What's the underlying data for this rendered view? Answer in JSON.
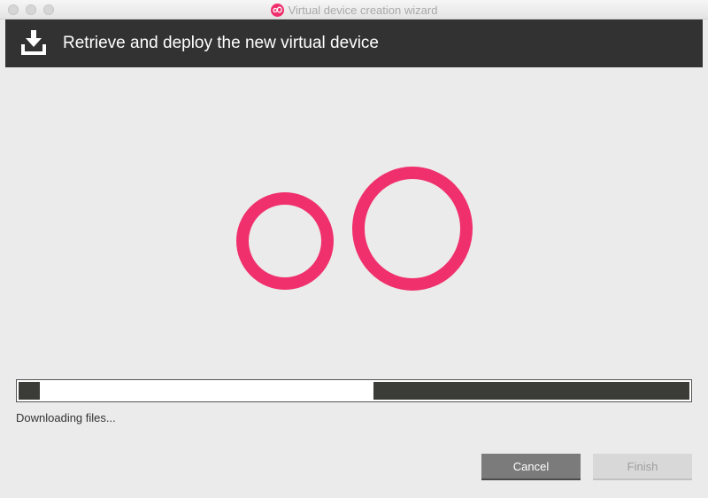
{
  "window": {
    "title": "Virtual device creation wizard",
    "app_icon": "genymotion-logo-icon"
  },
  "header": {
    "title": "Retrieve and deploy the new virtual device",
    "icon": "download-icon"
  },
  "logo": {
    "icon": "genymotion-logo",
    "color": "#f0306c"
  },
  "progress": {
    "status": "Downloading files...",
    "indeterminate": true
  },
  "buttons": {
    "cancel": "Cancel",
    "finish": "Finish",
    "finish_enabled": false
  },
  "colors": {
    "accent": "#f0306c",
    "banner": "#323232",
    "background": "#ebebeb"
  }
}
